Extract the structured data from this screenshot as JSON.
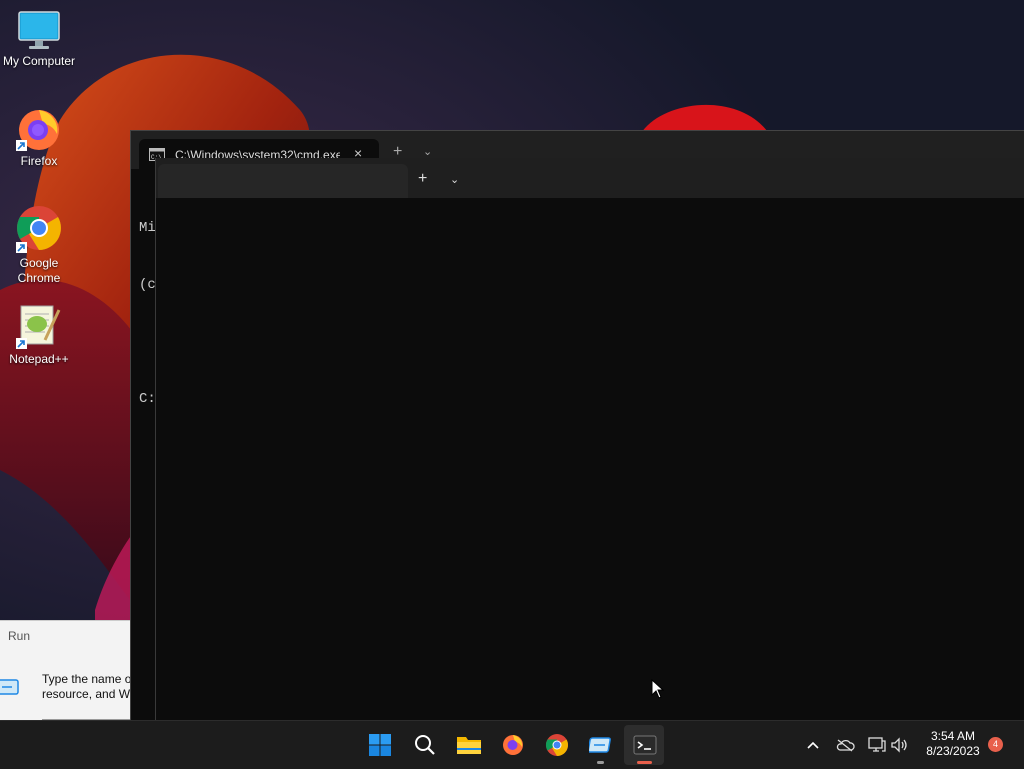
{
  "desktop": {
    "icons": [
      {
        "label": "My Computer",
        "icon": "monitor-icon"
      },
      {
        "label": "Firefox",
        "icon": "firefox-icon"
      },
      {
        "label": "Google Chrome",
        "icon": "chrome-icon"
      },
      {
        "label": "Notepad++",
        "icon": "notepadpp-icon"
      }
    ]
  },
  "run_dialog": {
    "title": "Run",
    "description_line1": "Type the name o",
    "description_line2": "resource, and Wi"
  },
  "terminal_back": {
    "tab_title": "C:\\Windows\\system32\\cmd.exe",
    "tab_close": "×",
    "new_tab": "+",
    "dropdown": "⌄",
    "lines": [
      "Mi",
      "(c",
      "",
      "C:"
    ]
  },
  "terminal_front": {
    "new_tab": "+",
    "dropdown": "⌄"
  },
  "taskbar": {
    "apps": [
      "start-icon",
      "search-icon",
      "file-explorer-icon",
      "firefox-icon",
      "chrome-icon",
      "run-icon",
      "terminal-icon"
    ],
    "active_app": "terminal-icon",
    "tray": {
      "chevron": "^",
      "time": "3:54 AM",
      "date": "8/23/2023",
      "notification_count": "4"
    }
  },
  "colors": {
    "taskbar_bg": "#1c1c1c",
    "terminal_bg": "#0c0c0c",
    "accent": "#0078d4",
    "notification_badge": "#e8604c",
    "active_indicator": "#e8604c"
  }
}
